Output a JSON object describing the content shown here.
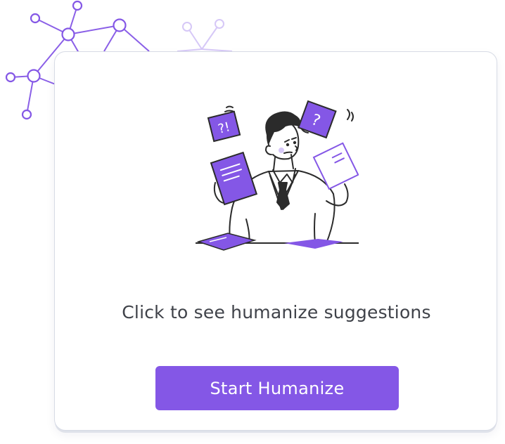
{
  "prompt": {
    "text": "Click to see humanize suggestions"
  },
  "cta": {
    "label": "Start Humanize"
  },
  "illustration": {
    "name": "confused-person-juggling-documents",
    "note_left_text": "?!",
    "note_right_text": "?"
  },
  "colors": {
    "accent": "#8457e6",
    "accent_light": "#d6c8f7",
    "text": "#3f4249",
    "card_border": "#d7dbe5",
    "ink": "#2b2b2b"
  }
}
